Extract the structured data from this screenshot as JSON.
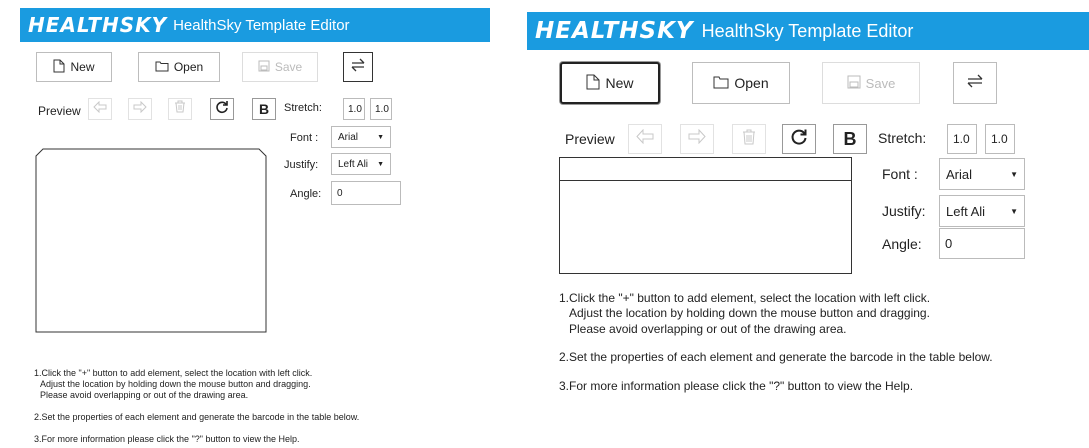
{
  "app": {
    "logo": "HEALTHSKY",
    "title": "HealthSky Template Editor"
  },
  "toolbar": {
    "new_label": "New",
    "open_label": "Open",
    "save_label": "Save"
  },
  "editor": {
    "preview_label": "Preview",
    "bold_label": "B",
    "stretch_label": "Stretch:",
    "stretch_x": "1.0",
    "stretch_y": "1.0",
    "font_label": "Font :",
    "font_value": "Arial",
    "justify_label": "Justify:",
    "justify_value": "Left Ali",
    "angle_label": "Angle:",
    "angle_value": "0"
  },
  "instructions": {
    "step1_line1": "1.Click the \"+\" button to add element, select the location with left click.",
    "step1_line2": "Adjust the location by holding down the mouse button and dragging.",
    "step1_line3": "Please avoid overlapping or out of the drawing area.",
    "step2": "2.Set the properties of each element and generate the barcode in the table below.",
    "step3": "3.For more information please click the \"?\" button to view the Help."
  },
  "colors": {
    "titlebar": "#1a9be0",
    "disabled": "#c8c8c8"
  }
}
